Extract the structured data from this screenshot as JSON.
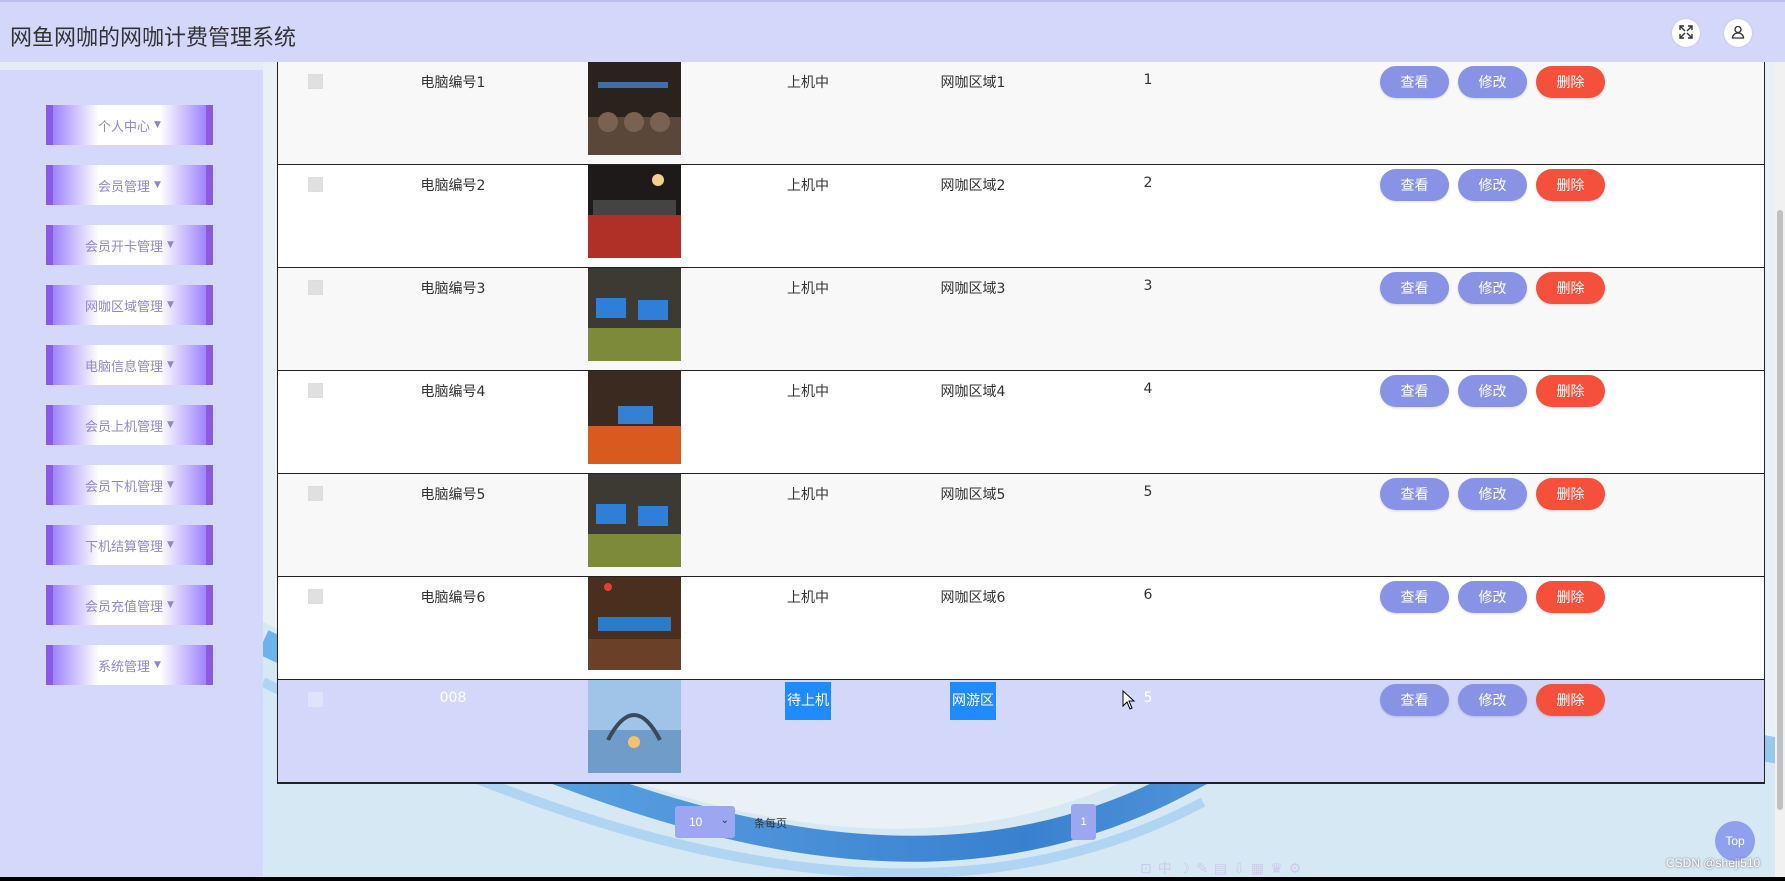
{
  "app": {
    "title": "网鱼网咖的网咖计费管理系统"
  },
  "header": {
    "fullscreen_icon": "expand-icon",
    "user_icon": "user-icon"
  },
  "sidebar": {
    "items": [
      {
        "label": "个人中心"
      },
      {
        "label": "会员管理"
      },
      {
        "label": "会员开卡管理"
      },
      {
        "label": "网咖区域管理"
      },
      {
        "label": "电脑信息管理"
      },
      {
        "label": "会员上机管理"
      },
      {
        "label": "会员下机管理"
      },
      {
        "label": "下机结算管理"
      },
      {
        "label": "会员充值管理"
      },
      {
        "label": "系统管理"
      }
    ]
  },
  "table": {
    "actions": {
      "view": "查看",
      "edit": "修改",
      "delete": "删除"
    },
    "rows": [
      {
        "name": "电脑编号1",
        "status": "上机中",
        "area": "网咖区域1",
        "num": "1"
      },
      {
        "name": "电脑编号2",
        "status": "上机中",
        "area": "网咖区域2",
        "num": "2"
      },
      {
        "name": "电脑编号3",
        "status": "上机中",
        "area": "网咖区域3",
        "num": "3"
      },
      {
        "name": "电脑编号4",
        "status": "上机中",
        "area": "网咖区域4",
        "num": "4"
      },
      {
        "name": "电脑编号5",
        "status": "上机中",
        "area": "网咖区域5",
        "num": "5"
      },
      {
        "name": "电脑编号6",
        "status": "上机中",
        "area": "网咖区域6",
        "num": "6"
      },
      {
        "name": "008",
        "status": "待上机",
        "area": "网游区",
        "num": "5"
      }
    ]
  },
  "pagination": {
    "page_size": "10",
    "per_page_label": "条每页",
    "current_page": "1"
  },
  "top_button": "Top",
  "watermark": "CSDN @sheji510",
  "colors": {
    "accent": "#8993e6",
    "danger": "#f4503c",
    "header": "#d3d8fb",
    "menu_border": "#8a5ae0"
  }
}
